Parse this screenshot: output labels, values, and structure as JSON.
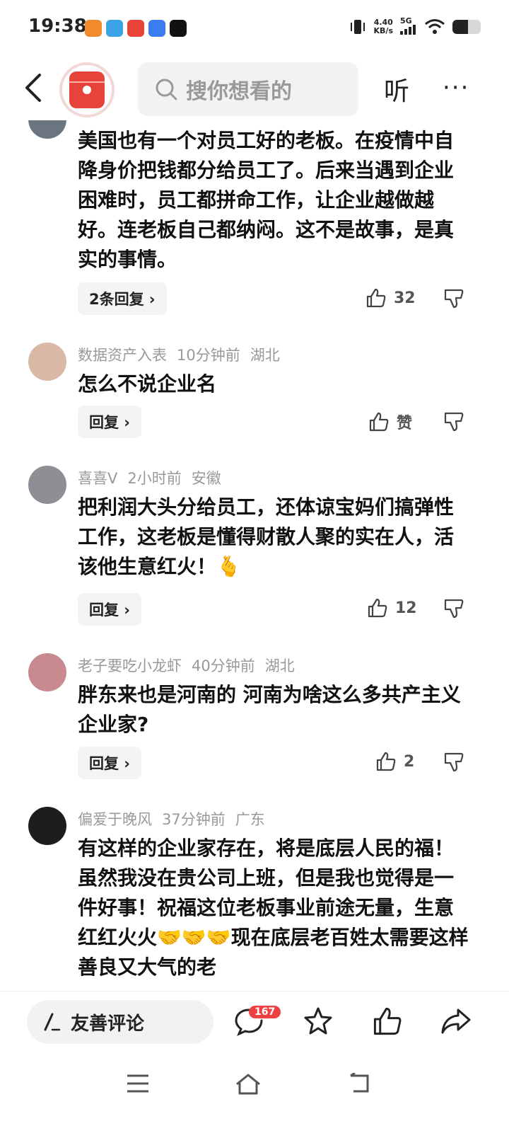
{
  "status_bar": {
    "time": "19:38",
    "net_speed": "4.40",
    "net_unit": "KB/s",
    "signal": "5G"
  },
  "top_nav": {
    "search_placeholder": "搜你想看的",
    "listen_label": "听",
    "more_label": "···"
  },
  "comments": [
    {
      "body": "美国也有一个对员工好的老板。在疫情中自降身价把钱都分给员工了。后来当遇到企业困难时，员工都拼命工作，让企业越做越好。连老板自己都纳闷。这不是故事，是真实的事情。",
      "reply_label": "2条回复 ›",
      "likes": "32"
    },
    {
      "user": "数据资产入表",
      "time": "10分钟前",
      "location": "湖北",
      "body": "怎么不说企业名",
      "reply_label": "回复 ›",
      "likes": "赞"
    },
    {
      "user": "喜喜V",
      "time": "2小时前",
      "location": "安徽",
      "body": "把利润大头分给员工，还体谅宝妈们搞弹性工作，这老板是懂得财散人聚的实在人，活该他生意红火！🫰",
      "reply_label": "回复 ›",
      "likes": "12"
    },
    {
      "user": "老子要吃小龙虾",
      "time": "40分钟前",
      "location": "湖北",
      "body": "胖东来也是河南的 河南为啥这么多共产主义企业家?",
      "reply_label": "回复 ›",
      "likes": "2"
    },
    {
      "user": "偏爱于晚风",
      "time": "37分钟前",
      "location": "广东",
      "body": "有这样的企业家存在，将是底层人民的福！虽然我没在贵公司上班，但是我也觉得是一件好事！祝福这位老板事业前途无量，生意红红火火🤝🤝🤝现在底层老百姓太需要这样善良又大气的老"
    }
  ],
  "bottom_bar": {
    "comment_placeholder": "友善评论",
    "comment_count": "167"
  },
  "colors": {
    "accent_red": "#f04142",
    "logo_red": "#e8433a"
  }
}
